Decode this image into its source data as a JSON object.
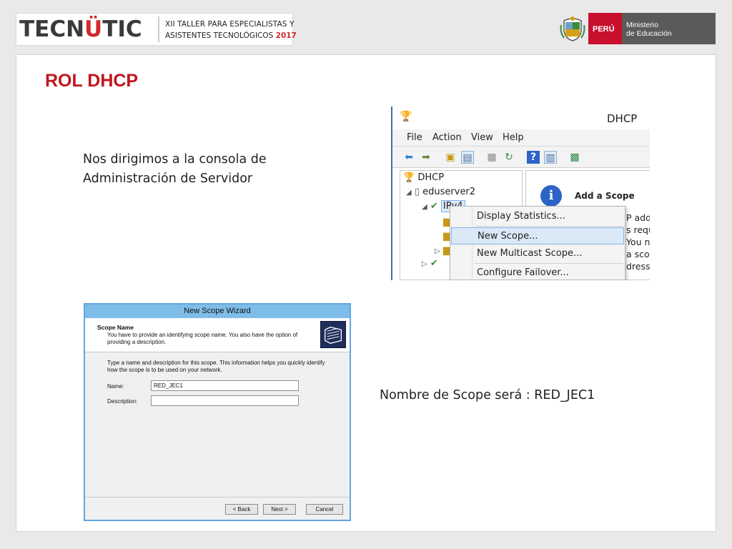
{
  "header": {
    "logo_prefix": "TECN",
    "logo_highlight": "Ü",
    "logo_suffix": "TIC",
    "event_line1": "XII TALLER PARA  ESPECIALISTAS  Y",
    "event_line2_text": "ASISTENTES TECNOLÓGICOS ",
    "event_year": "2017",
    "peru_label": "PERÚ",
    "ministry_line1": "Ministerio",
    "ministry_line2": "de Educación"
  },
  "slide": {
    "title": "ROL DHCP",
    "intro_line1": "Nos dirigimos a la consola de",
    "intro_line2": "Administración de Servidor",
    "scope_caption": "Nombre de Scope será : RED_JEC1"
  },
  "dhcp_console": {
    "window_title": "DHCP",
    "menu": [
      "File",
      "Action",
      "View",
      "Help"
    ],
    "tree": {
      "root": "DHCP",
      "server": "eduserver2",
      "ipv4": "IPv4"
    },
    "detail_title": "Add a Scope",
    "detail_lines": [
      "P add",
      "s requ",
      "You n",
      "a scop",
      "dresse"
    ],
    "context_menu": [
      "Display Statistics...",
      "New Scope...",
      "New Multicast Scope...",
      "Configure Failover..."
    ],
    "highlighted_item": "New Scope..."
  },
  "wizard": {
    "title": "New Scope Wizard",
    "step_title": "Scope Name",
    "step_description": "You have to provide an identifying scope name. You also have the option of providing a description.",
    "body_text": "Type a name and description for this scope. This information helps you quickly identify how the scope is to be used on your network.",
    "name_label": "Name:",
    "name_value": "RED_JEC1",
    "description_label": "Description:",
    "description_value": "",
    "back_button": "< Back",
    "next_button": "Next >",
    "cancel_button": "Cancel"
  },
  "colors": {
    "accent_red": "#c0161c",
    "peru_red": "#c8102e",
    "ministry_gray": "#5a5a5a",
    "wizard_title_blue": "#7fbde9",
    "menu_highlight": "#dbe9f7"
  }
}
